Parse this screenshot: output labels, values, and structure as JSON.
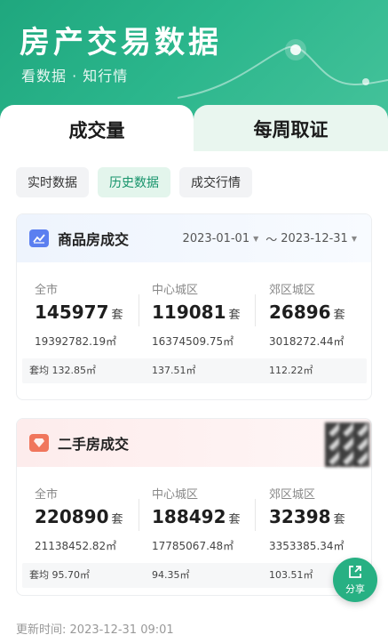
{
  "header": {
    "title": "房产交易数据",
    "subtitle": "看数据 · 知行情"
  },
  "main_tabs": [
    {
      "label": "成交量",
      "active": true
    },
    {
      "label": "每周取证",
      "active": false
    }
  ],
  "filter_chips": [
    {
      "label": "实时数据",
      "active": false
    },
    {
      "label": "历史数据",
      "active": true
    },
    {
      "label": "成交行情",
      "active": false
    }
  ],
  "new_house": {
    "title": "商品房成交",
    "badge_icon": "chart-icon",
    "badge_color": "#5b7ff0",
    "date_start": "2023-01-01",
    "date_sep": "～",
    "date_end": "2023-12-31",
    "columns": [
      {
        "label": "全市",
        "count": "145977",
        "unit": "套",
        "area": "19392782.19㎡",
        "avg": "套均 132.85㎡"
      },
      {
        "label": "中心城区",
        "count": "119081",
        "unit": "套",
        "area": "16374509.75㎡",
        "avg": "137.51㎡"
      },
      {
        "label": "郊区城区",
        "count": "26896",
        "unit": "套",
        "area": "3018272.44㎡",
        "avg": "112.22㎡"
      }
    ]
  },
  "resale_house": {
    "title": "二手房成交",
    "badge_icon": "diamond-icon",
    "badge_color": "#f0765c",
    "columns": [
      {
        "label": "全市",
        "count": "220890",
        "unit": "套",
        "area": "21138452.82㎡",
        "avg": "套均 95.70㎡"
      },
      {
        "label": "中心城区",
        "count": "188492",
        "unit": "套",
        "area": "17785067.48㎡",
        "avg": "94.35㎡"
      },
      {
        "label": "郊区城区",
        "count": "32398",
        "unit": "套",
        "area": "3353385.34㎡",
        "avg": "103.51㎡"
      }
    ]
  },
  "share": {
    "label": "分享",
    "icon": "share-icon"
  },
  "footer": {
    "update_label": "更新时间:",
    "update_time": "2023-12-31 09:01"
  },
  "colors": {
    "brand": "#27b083",
    "chip_active": "#17946b"
  }
}
